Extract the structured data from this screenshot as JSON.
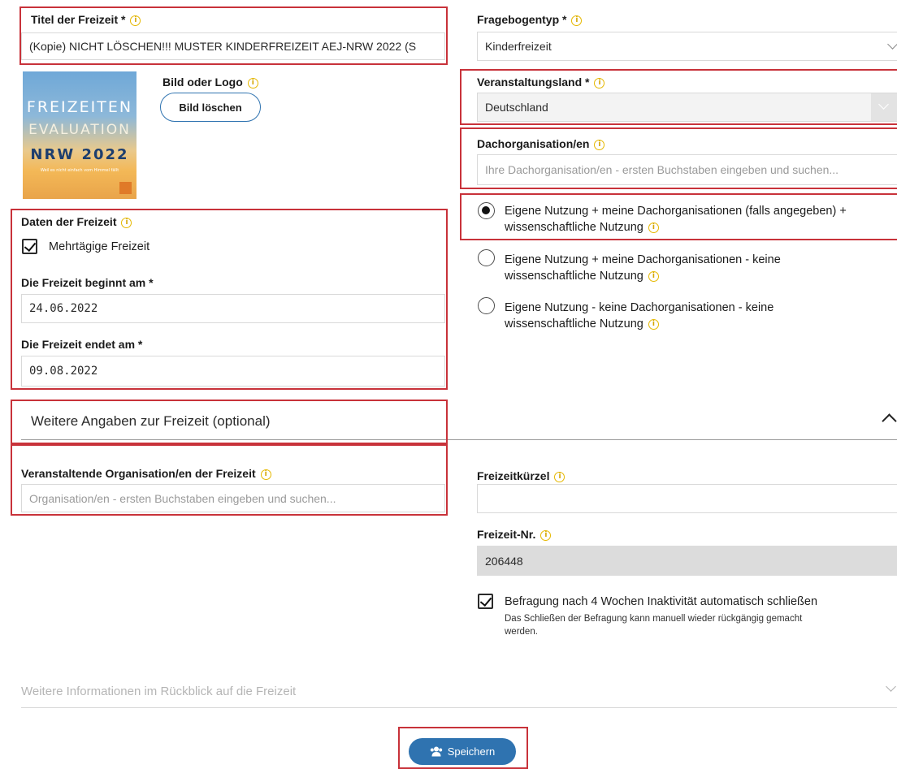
{
  "title_field": {
    "label": "Titel der Freizeit *",
    "value": "(Kopie) NICHT LÖSCHEN!!! MUSTER KINDERFREIZEIT AEJ-NRW 2022 (S"
  },
  "logo": {
    "label": "Bild oder Logo",
    "delete_button": "Bild löschen",
    "image_line1": "FREIZEITEN",
    "image_line2": "EVALUATION",
    "image_line3": "NRW 2022",
    "image_tagline": "Weil es nicht einfach vom Himmel fällt"
  },
  "dates": {
    "section_label": "Daten der Freizeit",
    "multiday_label": "Mehrtägige Freizeit",
    "start_label": "Die Freizeit beginnt am *",
    "start_value": "24.06.2022",
    "end_label": "Die Freizeit endet am *",
    "end_value": "09.08.2022"
  },
  "questionnaire": {
    "label": "Fragebogentyp *",
    "value": "Kinderfreizeit"
  },
  "country": {
    "label": "Veranstaltungsland *",
    "value": "Deutschland"
  },
  "umbrella": {
    "label": "Dachorganisation/en",
    "placeholder": "Ihre Dachorganisation/en - ersten Buchstaben eingeben und suchen..."
  },
  "usage_options": [
    {
      "line1": "Eigene Nutzung + meine Dachorganisationen (falls angegeben) +",
      "line2": "wissenschaftliche Nutzung",
      "checked": true
    },
    {
      "line1": "Eigene Nutzung + meine Dachorganisationen - keine",
      "line2": "wissenschaftliche Nutzung",
      "checked": false
    },
    {
      "line1": "Eigene Nutzung - keine Dachorganisationen - keine",
      "line2": "wissenschaftliche Nutzung",
      "checked": false
    }
  ],
  "more_info": {
    "title": "Weitere Angaben zur Freizeit (optional)",
    "organizer_label": "Veranstaltende Organisation/en der Freizeit",
    "organizer_placeholder": "Organisation/en - ersten Buchstaben eingeben und suchen...",
    "short_label": "Freizeitkürzel",
    "short_value": "",
    "number_label": "Freizeit-Nr.",
    "number_value": "206448",
    "autoclose_label": "Befragung nach 4 Wochen Inaktivität automatisch schließen",
    "autoclose_hint_line1": "Das Schließen der Befragung kann manuell wieder rückgängig gemacht",
    "autoclose_hint_line2": "werden."
  },
  "retrospective": {
    "title": "Weitere Informationen im Rückblick auf die Freizeit"
  },
  "save_button": "Speichern",
  "info_glyph": "i",
  "colors": {
    "highlight_red": "#c8323a",
    "primary_blue": "#2f73b0",
    "info_yellow": "#e6b800"
  }
}
